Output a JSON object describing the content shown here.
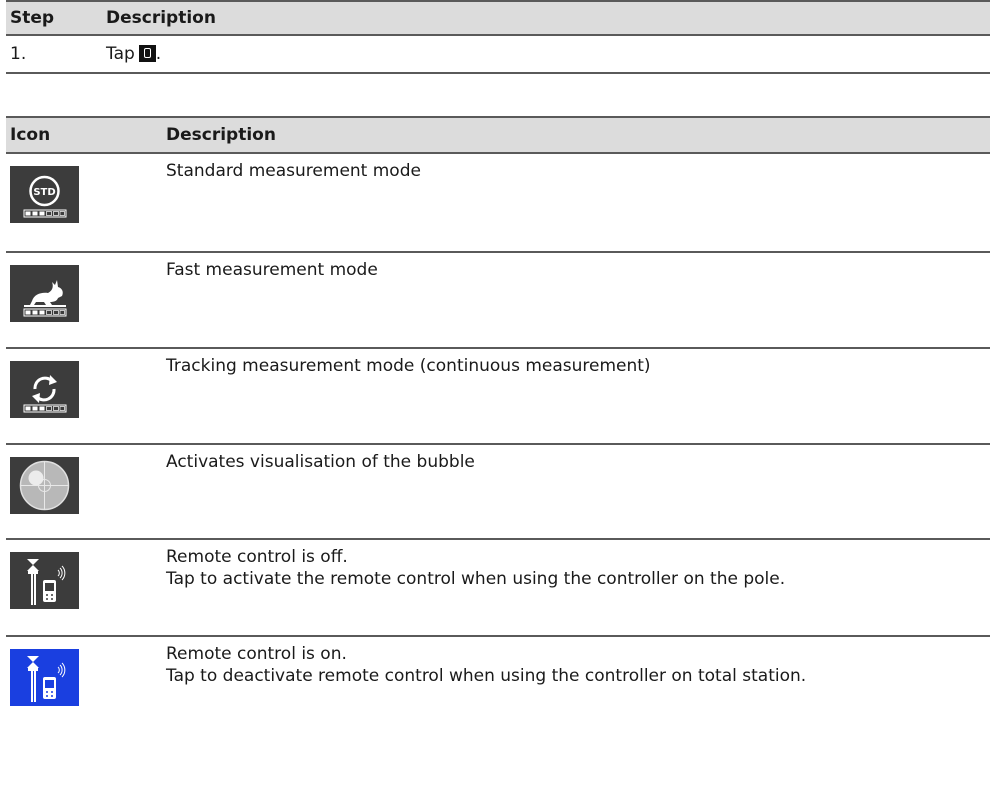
{
  "step_table": {
    "headers": [
      "Step",
      "Description"
    ],
    "rows": [
      {
        "step": "1.",
        "prefix": "Tap",
        "suffix": ".",
        "icon": "remote-mode-icon"
      }
    ]
  },
  "icon_table": {
    "headers": [
      "Icon",
      "Description"
    ],
    "rows": [
      {
        "icon": "std-measurement-icon",
        "lines": [
          "Standard measurement mode"
        ]
      },
      {
        "icon": "fast-measurement-icon",
        "lines": [
          "Fast measurement mode"
        ]
      },
      {
        "icon": "tracking-measurement-icon",
        "lines": [
          "Tracking measurement mode (continuous measurement)"
        ]
      },
      {
        "icon": "bubble-icon",
        "lines": [
          "Activates visualisation of the bubble"
        ]
      },
      {
        "icon": "remote-control-off-icon",
        "lines": [
          "Remote control is off.",
          "Tap to activate the remote control when using the controller on the pole."
        ]
      },
      {
        "icon": "remote-control-on-icon",
        "lines": [
          "Remote control is on.",
          "Tap to deactivate remote control when using the controller on total station."
        ]
      }
    ]
  },
  "colors": {
    "header_bg": "#dcdcdc",
    "icon_bg": "#3c3c3c",
    "active_icon_bg": "#1a3fe0",
    "rule": "#5a5a5a"
  }
}
